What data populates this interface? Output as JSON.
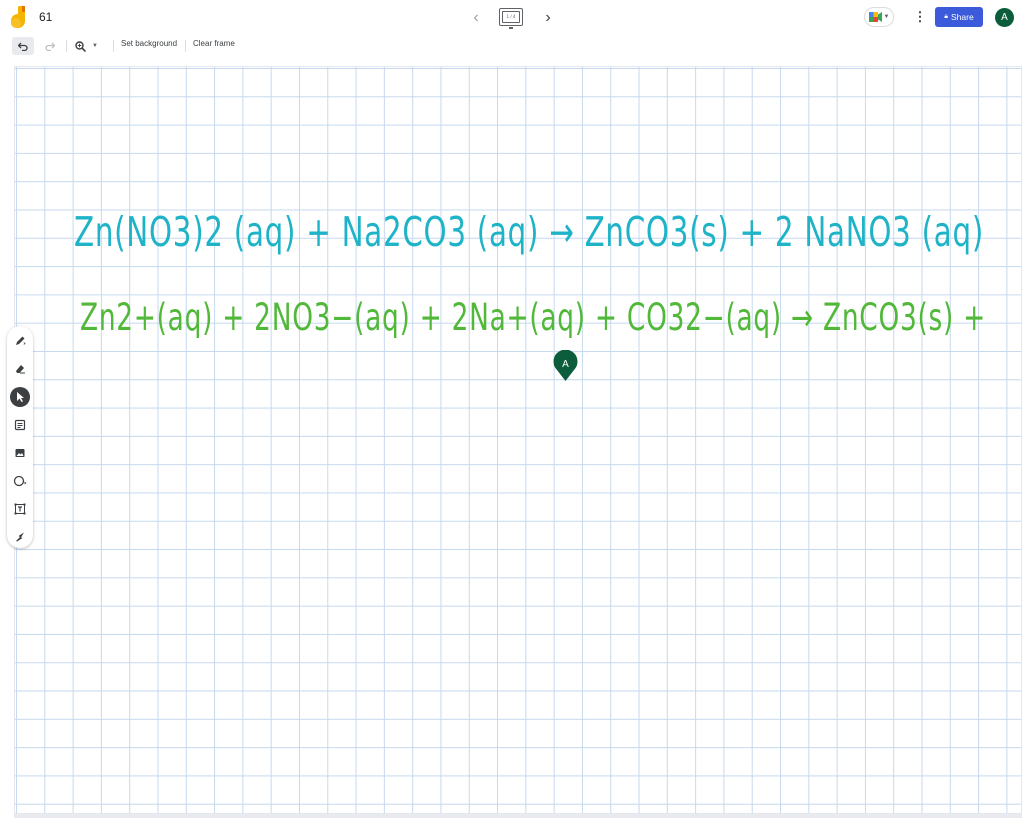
{
  "header": {
    "doc_title": "61",
    "share_label": "Share",
    "user_initial": "A",
    "frame_indicator": "1 / 4"
  },
  "toolbar": {
    "set_background_label": "Set background",
    "clear_frame_label": "Clear frame"
  },
  "colors": {
    "equation_1": "#1fb3c8",
    "equation_2": "#52b83a",
    "share_button": "#3b5bdb",
    "avatar": "#0b5d3b"
  },
  "board": {
    "equation_1": "Zn(NO3)2 (aq) + Na2CO3 (aq) → ZnCO3(s) + 2 NaNO3 (aq)",
    "equation_2": "Zn2+(aq) + 2NO3−(aq) + 2Na+(aq) + CO32−(aq) → ZnCO3(s)  +",
    "collaborator_initial": "A"
  },
  "tools": [
    {
      "icon": "pen-icon"
    },
    {
      "icon": "eraser-icon"
    },
    {
      "icon": "select-icon"
    },
    {
      "icon": "sticky-note-icon"
    },
    {
      "icon": "image-icon"
    },
    {
      "icon": "circle-icon"
    },
    {
      "icon": "text-box-icon"
    },
    {
      "icon": "laser-icon"
    }
  ]
}
